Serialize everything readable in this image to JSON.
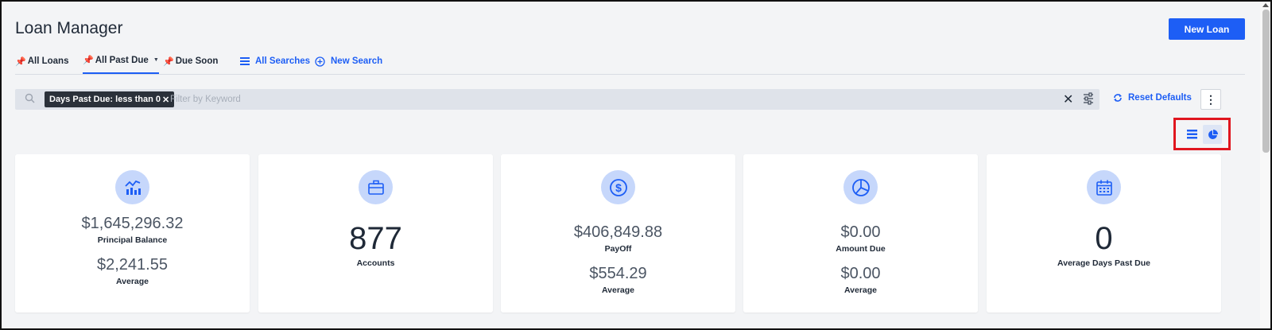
{
  "app": {
    "title": "Loan Manager",
    "new_loan_label": "New Loan"
  },
  "tabs": [
    {
      "label": "All Loans",
      "icon": "pin-icon"
    },
    {
      "label": "All Past Due",
      "icon": "pin-icon",
      "active": true
    },
    {
      "label": "Due Soon",
      "icon": "pin-icon"
    }
  ],
  "links": {
    "all_searches": "All Searches",
    "new_search": "New Search"
  },
  "filter": {
    "chip_label": "Days Past Due: less than 0",
    "chip_close": "✕",
    "placeholder": "Filter by Keyword",
    "clear_glyph": "✕",
    "reset_label": "Reset Defaults",
    "more_glyph": "⋮"
  },
  "cards": [
    {
      "icon": "chart-line-icon",
      "value": "$1,645,296.32",
      "label": "Principal Balance",
      "sub_value": "$2,241.55",
      "sub_label": "Average"
    },
    {
      "icon": "briefcase-icon",
      "value": "877",
      "label": "Accounts"
    },
    {
      "icon": "dollar-circle-icon",
      "value": "$406,849.88",
      "label": "PayOff",
      "sub_value": "$554.29",
      "sub_label": "Average"
    },
    {
      "icon": "pie-chart-icon",
      "value": "$0.00",
      "label": "Amount Due",
      "sub_value": "$0.00",
      "sub_label": "Average"
    },
    {
      "icon": "calendar-icon",
      "value": "0",
      "label": "Average Days Past Due"
    }
  ],
  "colors": {
    "accent": "#1d5ef5",
    "highlight_border": "#e0161f",
    "background": "#f3f4f6"
  }
}
